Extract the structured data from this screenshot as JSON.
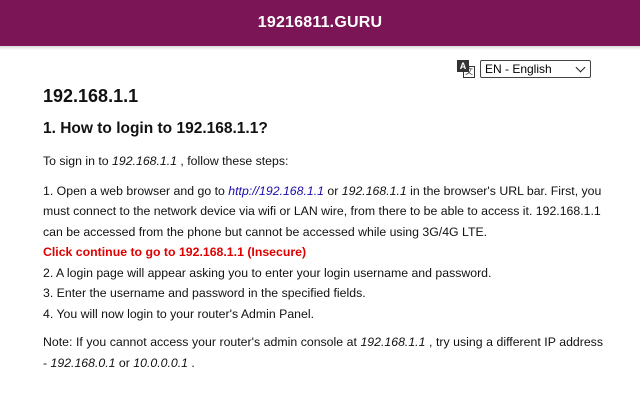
{
  "header": {
    "site_title": "19216811.GURU"
  },
  "language": {
    "icon": "translate-icon",
    "selected": "EN - English"
  },
  "article": {
    "title": "192.168.1.1",
    "section_title": "1. How to login to 192.168.1.1?",
    "intro_before": "To sign in to ",
    "intro_ip": "192.168.1.1",
    "intro_after": " , follow these steps:",
    "step1_before": "1. Open a web browser and go to ",
    "step1_link": "http://192.168.1.1",
    "step1_or": " or ",
    "step1_ip": "192.168.1.1",
    "step1_after": " in the browser's URL bar. First, you must connect to the network device via wifi or LAN wire, from there to be able to access it. 192.168.1.1 can be accessed from the phone but cannot be accessed while using 3G/4G LTE.",
    "continue_link": "Click continue to go to 192.168.1.1 (Insecure)",
    "step2": "2. A login page will appear asking you to enter your login username and password.",
    "step3": "3. Enter the username and password in the specified fields.",
    "step4": "4. You will now login to your router's Admin Panel.",
    "note_before": "Note: If you cannot access your router's admin console at ",
    "note_ip1": "192.168.1.1",
    "note_mid": " , try using a different IP address - ",
    "note_ip2": "192.168.0.1",
    "note_or": " or ",
    "note_ip3": "10.0.0.0.1",
    "note_after": " ."
  },
  "colors": {
    "header_bg": "#7b1556",
    "warning": "#e00000",
    "link": "#1a0dab"
  }
}
